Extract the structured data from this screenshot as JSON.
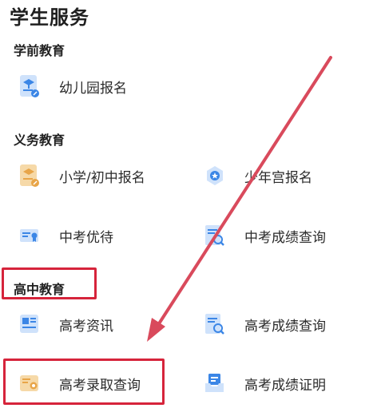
{
  "page_title": "学生服务",
  "sections": [
    {
      "title": "学前教育",
      "items": [
        {
          "label": "幼儿园报名",
          "icon": "kindergarten-icon"
        }
      ]
    },
    {
      "title": "义务教育",
      "items": [
        {
          "label": "小学/初中报名",
          "icon": "school-enroll-icon"
        },
        {
          "label": "少年宫报名",
          "icon": "youth-palace-icon"
        },
        {
          "label": "中考优待",
          "icon": "certificate-icon"
        },
        {
          "label": "中考成绩查询",
          "icon": "score-search-icon"
        }
      ]
    },
    {
      "title": "高中教育",
      "items": [
        {
          "label": "高考资讯",
          "icon": "news-icon"
        },
        {
          "label": "高考成绩查询",
          "icon": "score-search-icon"
        },
        {
          "label": "高考录取查询",
          "icon": "admission-search-icon"
        },
        {
          "label": "高考成绩证明",
          "icon": "inbox-icon"
        }
      ]
    }
  ],
  "colors": {
    "accent_blue": "#3b86e6",
    "icon_light_blue": "#cfe2fb",
    "icon_orange": "#e8a548",
    "highlight_red": "#d6243b"
  }
}
